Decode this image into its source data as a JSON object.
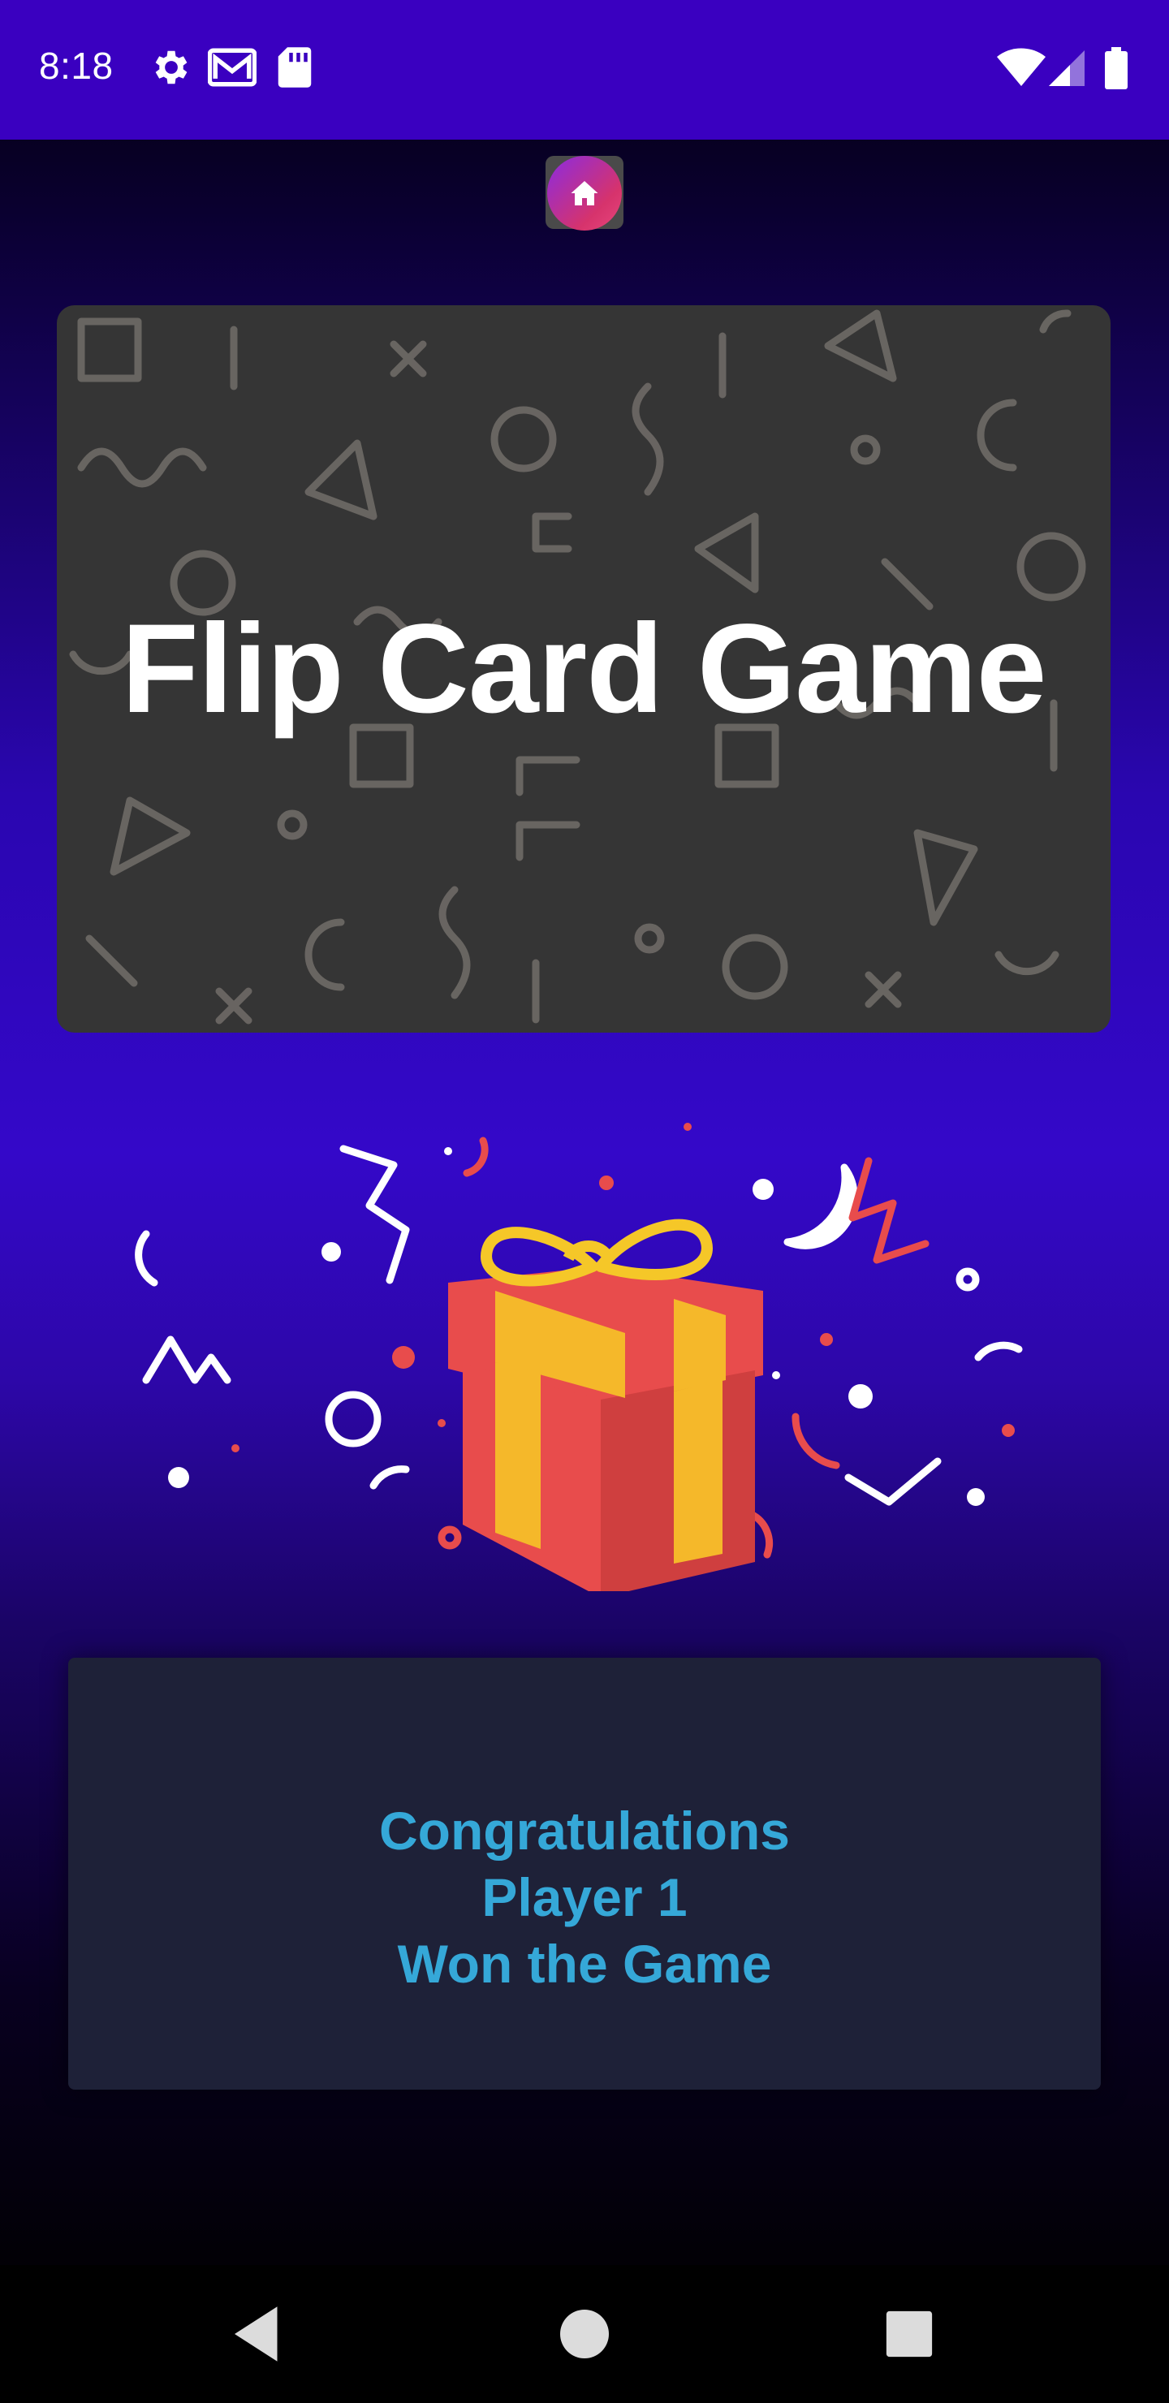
{
  "status_bar": {
    "time": "8:18",
    "left_icons": [
      "gear-icon",
      "gmail-icon",
      "sd-card-icon"
    ],
    "right_icons": [
      "wifi-icon",
      "cell-signal-icon",
      "battery-icon"
    ],
    "background_color": "#3a00c0"
  },
  "home_button": {
    "icon": "home-icon"
  },
  "title_card": {
    "title": "Flip Card Game",
    "background_color": "#353535"
  },
  "illustration": {
    "icon": "gift-box-icon"
  },
  "result": {
    "line1": "Congratulations",
    "line2": "Player 1",
    "line3": "Won the Game",
    "text_color": "#35a8d8",
    "panel_color": "#1e2138"
  },
  "nav_bar": {
    "back": "back-triangle-icon",
    "home": "home-circle-icon",
    "recents": "recents-square-icon"
  }
}
